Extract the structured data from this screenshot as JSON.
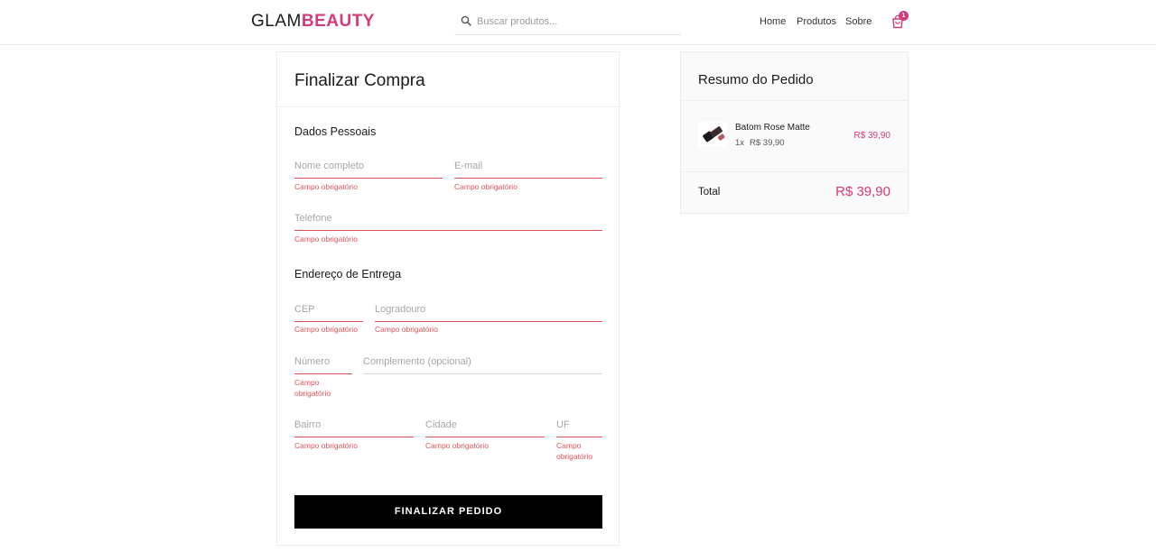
{
  "header": {
    "logo_part1": "GLAM",
    "logo_part2": "BEAUTY",
    "search_placeholder": "Buscar produtos...",
    "nav": [
      "Home",
      "Produtos",
      "Sobre"
    ],
    "cart_count": "1",
    "icons": {
      "search": "search-icon",
      "cart": "shopping-bag-icon"
    }
  },
  "checkout": {
    "title": "Finalizar Compra",
    "personal_section": "Dados Pessoais",
    "address_section": "Endereço de Entrega",
    "fields": {
      "nome": {
        "placeholder": "Nome completo",
        "error": "Campo obrigatório"
      },
      "email": {
        "placeholder": "E-mail",
        "error": "Campo obrigatório"
      },
      "telefone": {
        "placeholder": "Telefone",
        "error": "Campo obrigatório"
      },
      "cep": {
        "placeholder": "CEP",
        "error": "Campo obrigatório"
      },
      "logradouro": {
        "placeholder": "Logradouro",
        "error": "Campo obrigatório"
      },
      "numero": {
        "placeholder": "Número",
        "error": "Campo obrigatório"
      },
      "complemento": {
        "placeholder": "Complemento (opcional)"
      },
      "bairro": {
        "placeholder": "Bairro",
        "error": "Campo obrigatório"
      },
      "cidade": {
        "placeholder": "Cidade",
        "error": "Campo obrigatório"
      },
      "uf": {
        "placeholder": "UF",
        "error": "Campo obrigatório"
      }
    },
    "submit_label": "FINALIZAR PEDIDO"
  },
  "summary": {
    "title": "Resumo do Pedido",
    "items": [
      {
        "name": "Batom Rose Matte",
        "qty": "1x",
        "unit_price": "R$ 39,90",
        "price": "R$ 39,90"
      }
    ],
    "total_label": "Total",
    "total_value": "R$ 39,90"
  },
  "colors": {
    "accent": "#d63a7a",
    "error": "#e2545a",
    "button": "#000000"
  }
}
